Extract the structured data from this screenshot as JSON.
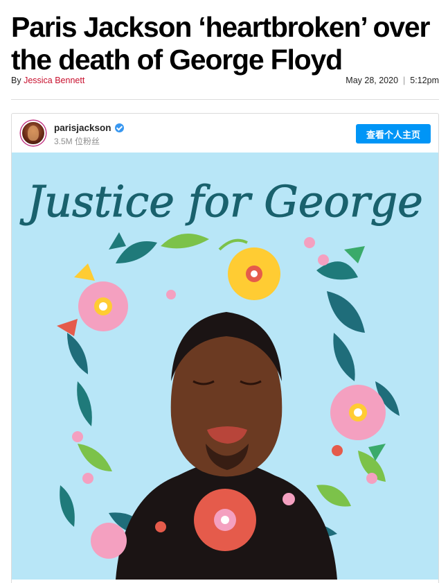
{
  "article": {
    "headline": "Paris Jackson ‘heartbroken’ over the death of George Floyd",
    "byline_prefix": "By ",
    "author": "Jessica Bennett",
    "date": "May 28, 2020",
    "time": "5:12pm",
    "separator": "|"
  },
  "embed": {
    "username": "parisjackson",
    "followers": "3.5M 位粉丝",
    "profile_button": "查看个人主页",
    "image_caption_text": "Justice for George"
  },
  "colors": {
    "author_link": "#c8102e",
    "button_blue": "#0095f6",
    "image_bg": "#b8e6f7"
  }
}
